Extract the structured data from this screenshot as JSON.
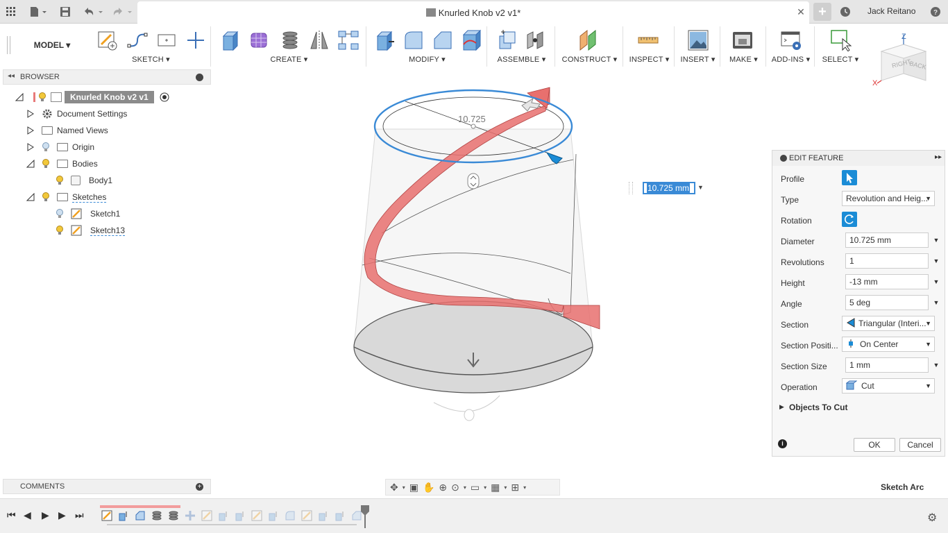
{
  "titlebar": {
    "document_title": "Knurled Knob v2 v1*",
    "user_name": "Jack Reitano",
    "icons": [
      "apps-grid-icon",
      "file-icon",
      "save-icon",
      "undo-icon",
      "redo-icon",
      "close-icon",
      "new-tab-icon",
      "job-status-icon",
      "help-icon"
    ]
  },
  "toolbar": {
    "workspace": "MODEL",
    "groups": [
      {
        "label": "SKETCH"
      },
      {
        "label": "CREATE"
      },
      {
        "label": "MODIFY"
      },
      {
        "label": "ASSEMBLE"
      },
      {
        "label": "CONSTRUCT"
      },
      {
        "label": "INSPECT"
      },
      {
        "label": "INSERT"
      },
      {
        "label": "MAKE"
      },
      {
        "label": "ADD-INS"
      },
      {
        "label": "SELECT"
      }
    ]
  },
  "viewcube": {
    "faces": [
      "RIGHT",
      "BACK"
    ],
    "axes": [
      "Z",
      "X"
    ]
  },
  "browser": {
    "title": "BROWSER",
    "root": "Knurled Knob v2 v1",
    "items": [
      {
        "label": "Document Settings"
      },
      {
        "label": "Named Views"
      },
      {
        "label": "Origin"
      },
      {
        "label": "Bodies"
      },
      {
        "label": "Body1"
      },
      {
        "label": "Sketches"
      },
      {
        "label": "Sketch1"
      },
      {
        "label": "Sketch13"
      }
    ]
  },
  "comments": {
    "title": "COMMENTS"
  },
  "viewport": {
    "dimension_label": "10.725",
    "dimension_input": "10.725 mm"
  },
  "edit_feature": {
    "title": "EDIT FEATURE",
    "rows": [
      {
        "label": "Profile"
      },
      {
        "label": "Type",
        "value": "Revolution and Heig..."
      },
      {
        "label": "Rotation"
      },
      {
        "label": "Diameter",
        "value": "10.725 mm"
      },
      {
        "label": "Revolutions",
        "value": "1"
      },
      {
        "label": "Height",
        "value": "-13 mm"
      },
      {
        "label": "Angle",
        "value": "5 deg"
      },
      {
        "label": "Section",
        "value": "Triangular (Interi..."
      },
      {
        "label": "Section Positi...",
        "value": "On Center"
      },
      {
        "label": "Section Size",
        "value": "1 mm"
      },
      {
        "label": "Operation",
        "value": "Cut"
      }
    ],
    "objects_to_cut": "Objects To Cut",
    "ok": "OK",
    "cancel": "Cancel"
  },
  "status": {
    "text": "Sketch Arc"
  },
  "colors": {
    "accent": "#1b8cd6",
    "helix": "#e8706e",
    "selection": "#3a8ad6"
  }
}
